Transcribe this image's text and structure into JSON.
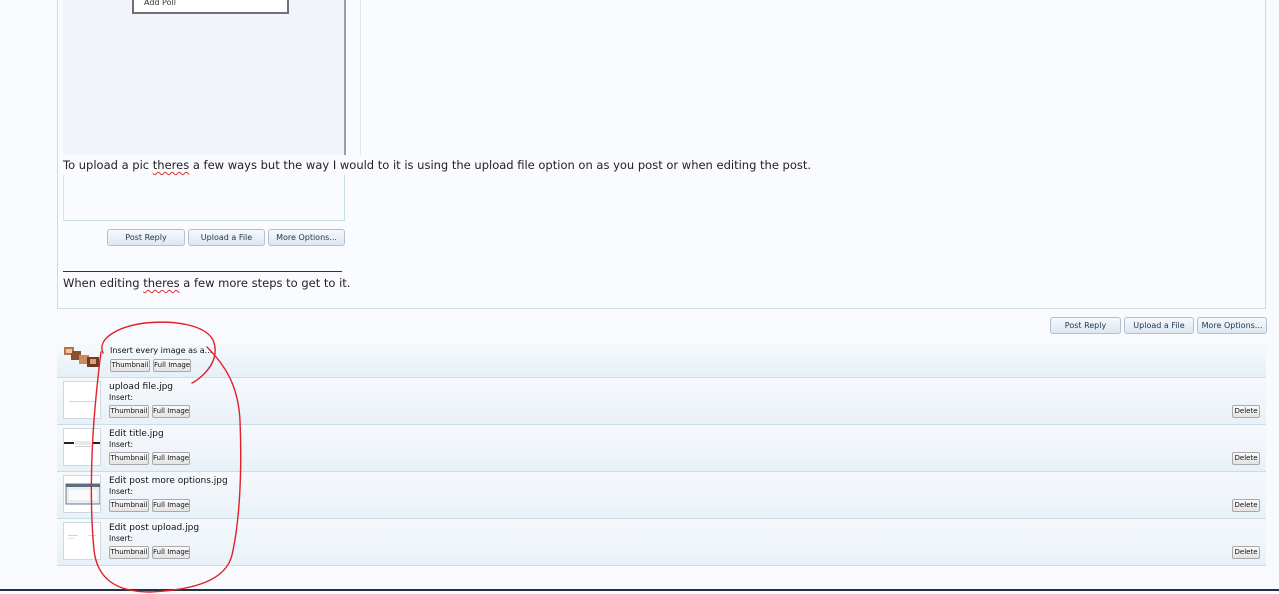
{
  "embedded_screenshot": {
    "menu_item": "Add Poll"
  },
  "post": {
    "line1_pre": "To upload a pic ",
    "line1_misspelled": "theres",
    "line1_post": " a few ways but the way I would to it is using the upload file option on as you post or when editing the post.",
    "embedded_buttons": [
      "Post Reply",
      "Upload a File",
      "More Options..."
    ],
    "line2_pre": "When editing ",
    "line2_misspelled": "theres",
    "line2_post": " a few more steps to get to it."
  },
  "toolbar": {
    "post_reply": "Post Reply",
    "upload_file": "Upload a File",
    "more_options": "More Options..."
  },
  "attachments": {
    "insert_all_label": "Insert every image as a...",
    "insert_label": "Insert:",
    "thumbnail_label": "Thumbnail",
    "full_image_label": "Full Image",
    "delete_label": "Delete",
    "files": [
      "upload file.jpg",
      "Edit title.jpg",
      "Edit post more options.jpg",
      "Edit post upload.jpg"
    ]
  },
  "annotation": {
    "stroke_color": "#e0202a"
  }
}
